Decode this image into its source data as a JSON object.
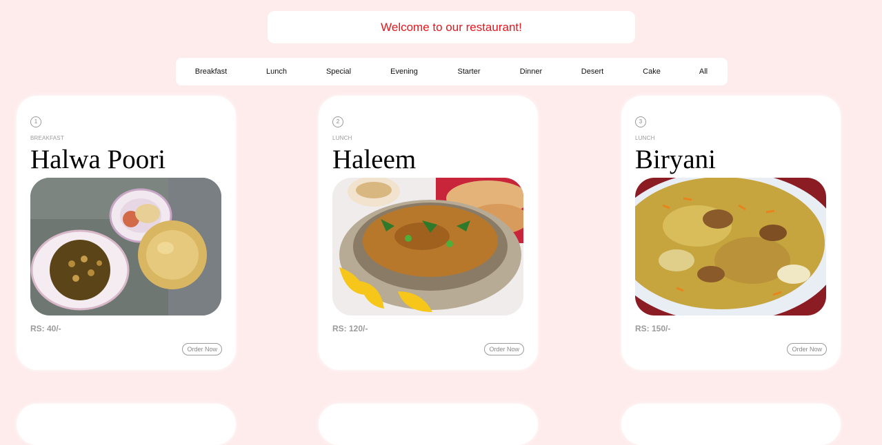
{
  "banner": {
    "text": "Welcome to our restaurant!"
  },
  "nav": {
    "items": [
      "Breakfast",
      "Lunch",
      "Special",
      "Evening",
      "Starter",
      "Dinner",
      "Desert",
      "Cake",
      "All"
    ]
  },
  "cards": [
    {
      "number": "1",
      "category": "BREAKFAST",
      "title": "Halwa Poori",
      "price": "RS: 40/-",
      "button": "Order Now",
      "image_icon": "halwa-poori-photo"
    },
    {
      "number": "2",
      "category": "LUNCH",
      "title": "Haleem",
      "price": "RS: 120/-",
      "button": "Order Now",
      "image_icon": "haleem-photo"
    },
    {
      "number": "3",
      "category": "LUNCH",
      "title": "Biryani",
      "price": "RS: 150/-",
      "button": "Order Now",
      "image_icon": "biryani-photo"
    }
  ],
  "colors": {
    "page_background": "#feecec",
    "banner_text": "#e8141c",
    "card_background": "#ffffff",
    "muted_text": "#9a9a9a"
  }
}
